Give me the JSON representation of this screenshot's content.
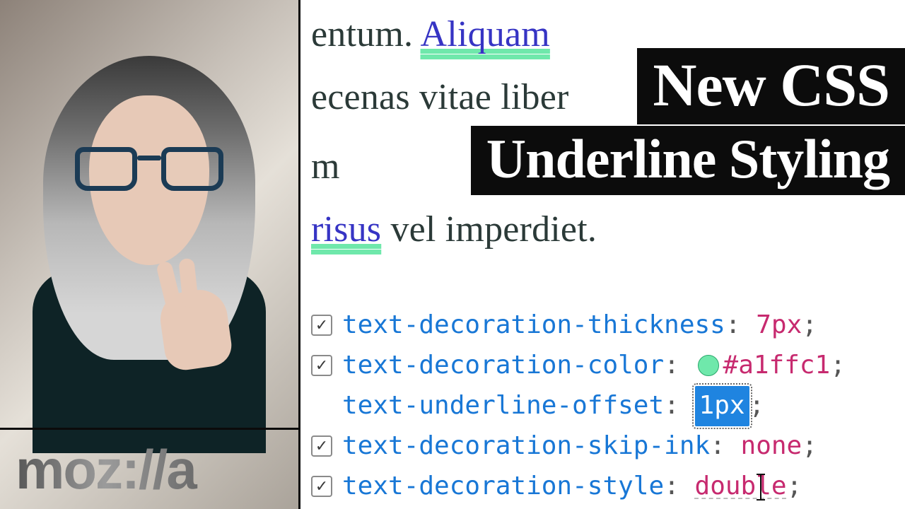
{
  "brand": {
    "logo_text": "moz://a"
  },
  "title": {
    "line1": "New CSS",
    "line2": "Underline Styling"
  },
  "demo": {
    "l1_pre": "entum. ",
    "l1_link": "Aliquam",
    "l2": "ecenas vitae liber",
    "l3_pre": "m",
    "l4_link": "risus",
    "l4_post": " vel imperdiet."
  },
  "rules": [
    {
      "checked": true,
      "prop": "text-decoration-thickness",
      "value": "7px",
      "swatch": false,
      "selected": false
    },
    {
      "checked": true,
      "prop": "text-decoration-color",
      "value": "#a1ffc1",
      "swatch": true,
      "selected": false
    },
    {
      "checked": null,
      "prop": "text-underline-offset",
      "value": "1px",
      "swatch": false,
      "selected": true
    },
    {
      "checked": true,
      "prop": "text-decoration-skip-ink",
      "value": "none",
      "swatch": false,
      "selected": false
    },
    {
      "checked": true,
      "prop": "text-decoration-style",
      "value": "double",
      "swatch": false,
      "selected": false,
      "caret": true
    }
  ],
  "colors": {
    "underline": "#6fe8ab",
    "link": "#3634c4",
    "prop": "#1877d6",
    "val": "#c72a6f"
  }
}
